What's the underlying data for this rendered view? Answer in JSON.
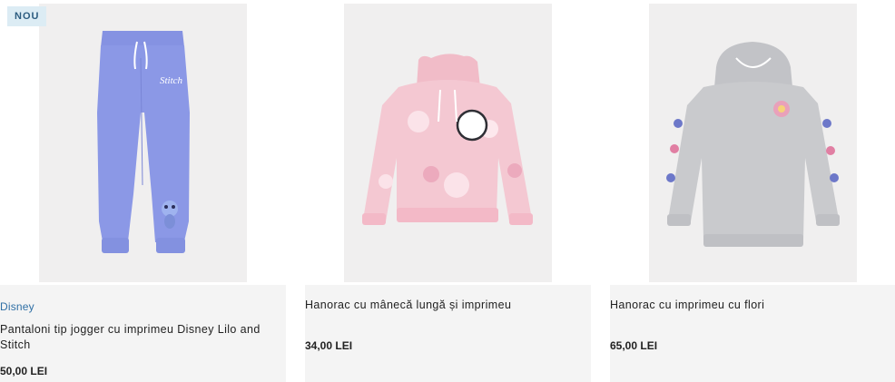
{
  "products": [
    {
      "badge": "NOU",
      "brand": "Disney",
      "name": "Pantaloni tip jogger cu imprimeu Disney Lilo and Stitch",
      "price": "50,00 LEI",
      "print_text": "Stitch"
    },
    {
      "name": "Hanorac cu mânecă lungă și imprimeu",
      "price": "34,00 LEI"
    },
    {
      "name": "Hanorac cu imprimeu cu flori",
      "price": "65,00 LEI"
    }
  ],
  "colors": {
    "card_bg": "#f4f4f4",
    "badge_bg": "#dcecf4",
    "brand_blue": "#2f6fa5",
    "jogger": "#8b98e6",
    "hoodie_pink": "#f4c8d2",
    "hoodie_grey": "#c9cacd"
  }
}
